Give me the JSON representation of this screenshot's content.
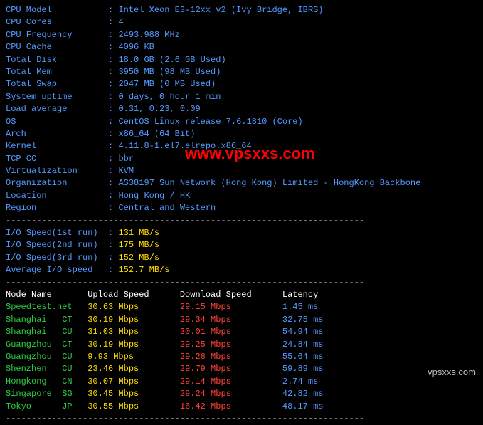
{
  "sysinfo": [
    {
      "label": "CPU Model",
      "value": "Intel Xeon E3-12xx v2 (Ivy Bridge, IBRS)"
    },
    {
      "label": "CPU Cores",
      "value": "4"
    },
    {
      "label": "CPU Frequency",
      "value": "2493.988 MHz"
    },
    {
      "label": "CPU Cache",
      "value": "4096 KB"
    },
    {
      "label": "Total Disk",
      "value": "18.0 GB (2.6 GB Used)"
    },
    {
      "label": "Total Mem",
      "value": "3950 MB (98 MB Used)"
    },
    {
      "label": "Total Swap",
      "value": "2047 MB (0 MB Used)"
    },
    {
      "label": "System uptime",
      "value": "0 days, 0 hour 1 min"
    },
    {
      "label": "Load average",
      "value": "0.31, 0.23, 0.09"
    },
    {
      "label": "OS",
      "value": "CentOS Linux release 7.6.1810 (Core)"
    },
    {
      "label": "Arch",
      "value": "x86_64 (64 Bit)"
    },
    {
      "label": "Kernel",
      "value": "4.11.8-1.el7.elrepo.x86_64"
    },
    {
      "label": "TCP CC",
      "value": "bbr"
    },
    {
      "label": "Virtualization",
      "value": "KVM"
    },
    {
      "label": "Organization",
      "value": "AS38197 Sun Network (Hong Kong) Limited - HongKong Backbone"
    },
    {
      "label": "Location",
      "value": "Hong Kong / HK"
    },
    {
      "label": "Region",
      "value": "Central and Western"
    }
  ],
  "iospeed": [
    {
      "label": "I/O Speed(1st run)",
      "value": "131 MB/s"
    },
    {
      "label": "I/O Speed(2nd run)",
      "value": "175 MB/s"
    },
    {
      "label": "I/O Speed(3rd run)",
      "value": "152 MB/s"
    },
    {
      "label": "Average I/O speed",
      "value": "152.7 MB/s"
    }
  ],
  "speedtest": {
    "headers": {
      "node": "Node Name",
      "up": "Upload Speed",
      "dn": "Download Speed",
      "lat": "Latency"
    },
    "rows": [
      {
        "node": "Speedtest.net",
        "up": "30.63 Mbps",
        "dn": "29.15 Mbps",
        "lat": "1.45 ms"
      },
      {
        "node": "Shanghai   CT",
        "up": "30.19 Mbps",
        "dn": "29.34 Mbps",
        "lat": "32.75 ms"
      },
      {
        "node": "Shanghai   CU",
        "up": "31.03 Mbps",
        "dn": "30.01 Mbps",
        "lat": "54.94 ms"
      },
      {
        "node": "Guangzhou  CT",
        "up": "30.19 Mbps",
        "dn": "29.25 Mbps",
        "lat": "24.84 ms"
      },
      {
        "node": "Guangzhou  CU",
        "up": "9.93 Mbps",
        "dn": "29.28 Mbps",
        "lat": "55.64 ms"
      },
      {
        "node": "Shenzhen   CU",
        "up": "23.46 Mbps",
        "dn": "29.79 Mbps",
        "lat": "59.89 ms"
      },
      {
        "node": "Hongkong   CN",
        "up": "30.07 Mbps",
        "dn": "29.14 Mbps",
        "lat": "2.74 ms"
      },
      {
        "node": "Singapore  SG",
        "up": "30.45 Mbps",
        "dn": "29.24 Mbps",
        "lat": "42.82 ms"
      },
      {
        "node": "Tokyo      JP",
        "up": "30.55 Mbps",
        "dn": "16.42 Mbps",
        "lat": "48.17 ms"
      }
    ]
  },
  "divider": "----------------------------------------------------------------------",
  "watermark": "www.vpsxxs.com",
  "watermark2": "vpsxxs.com"
}
